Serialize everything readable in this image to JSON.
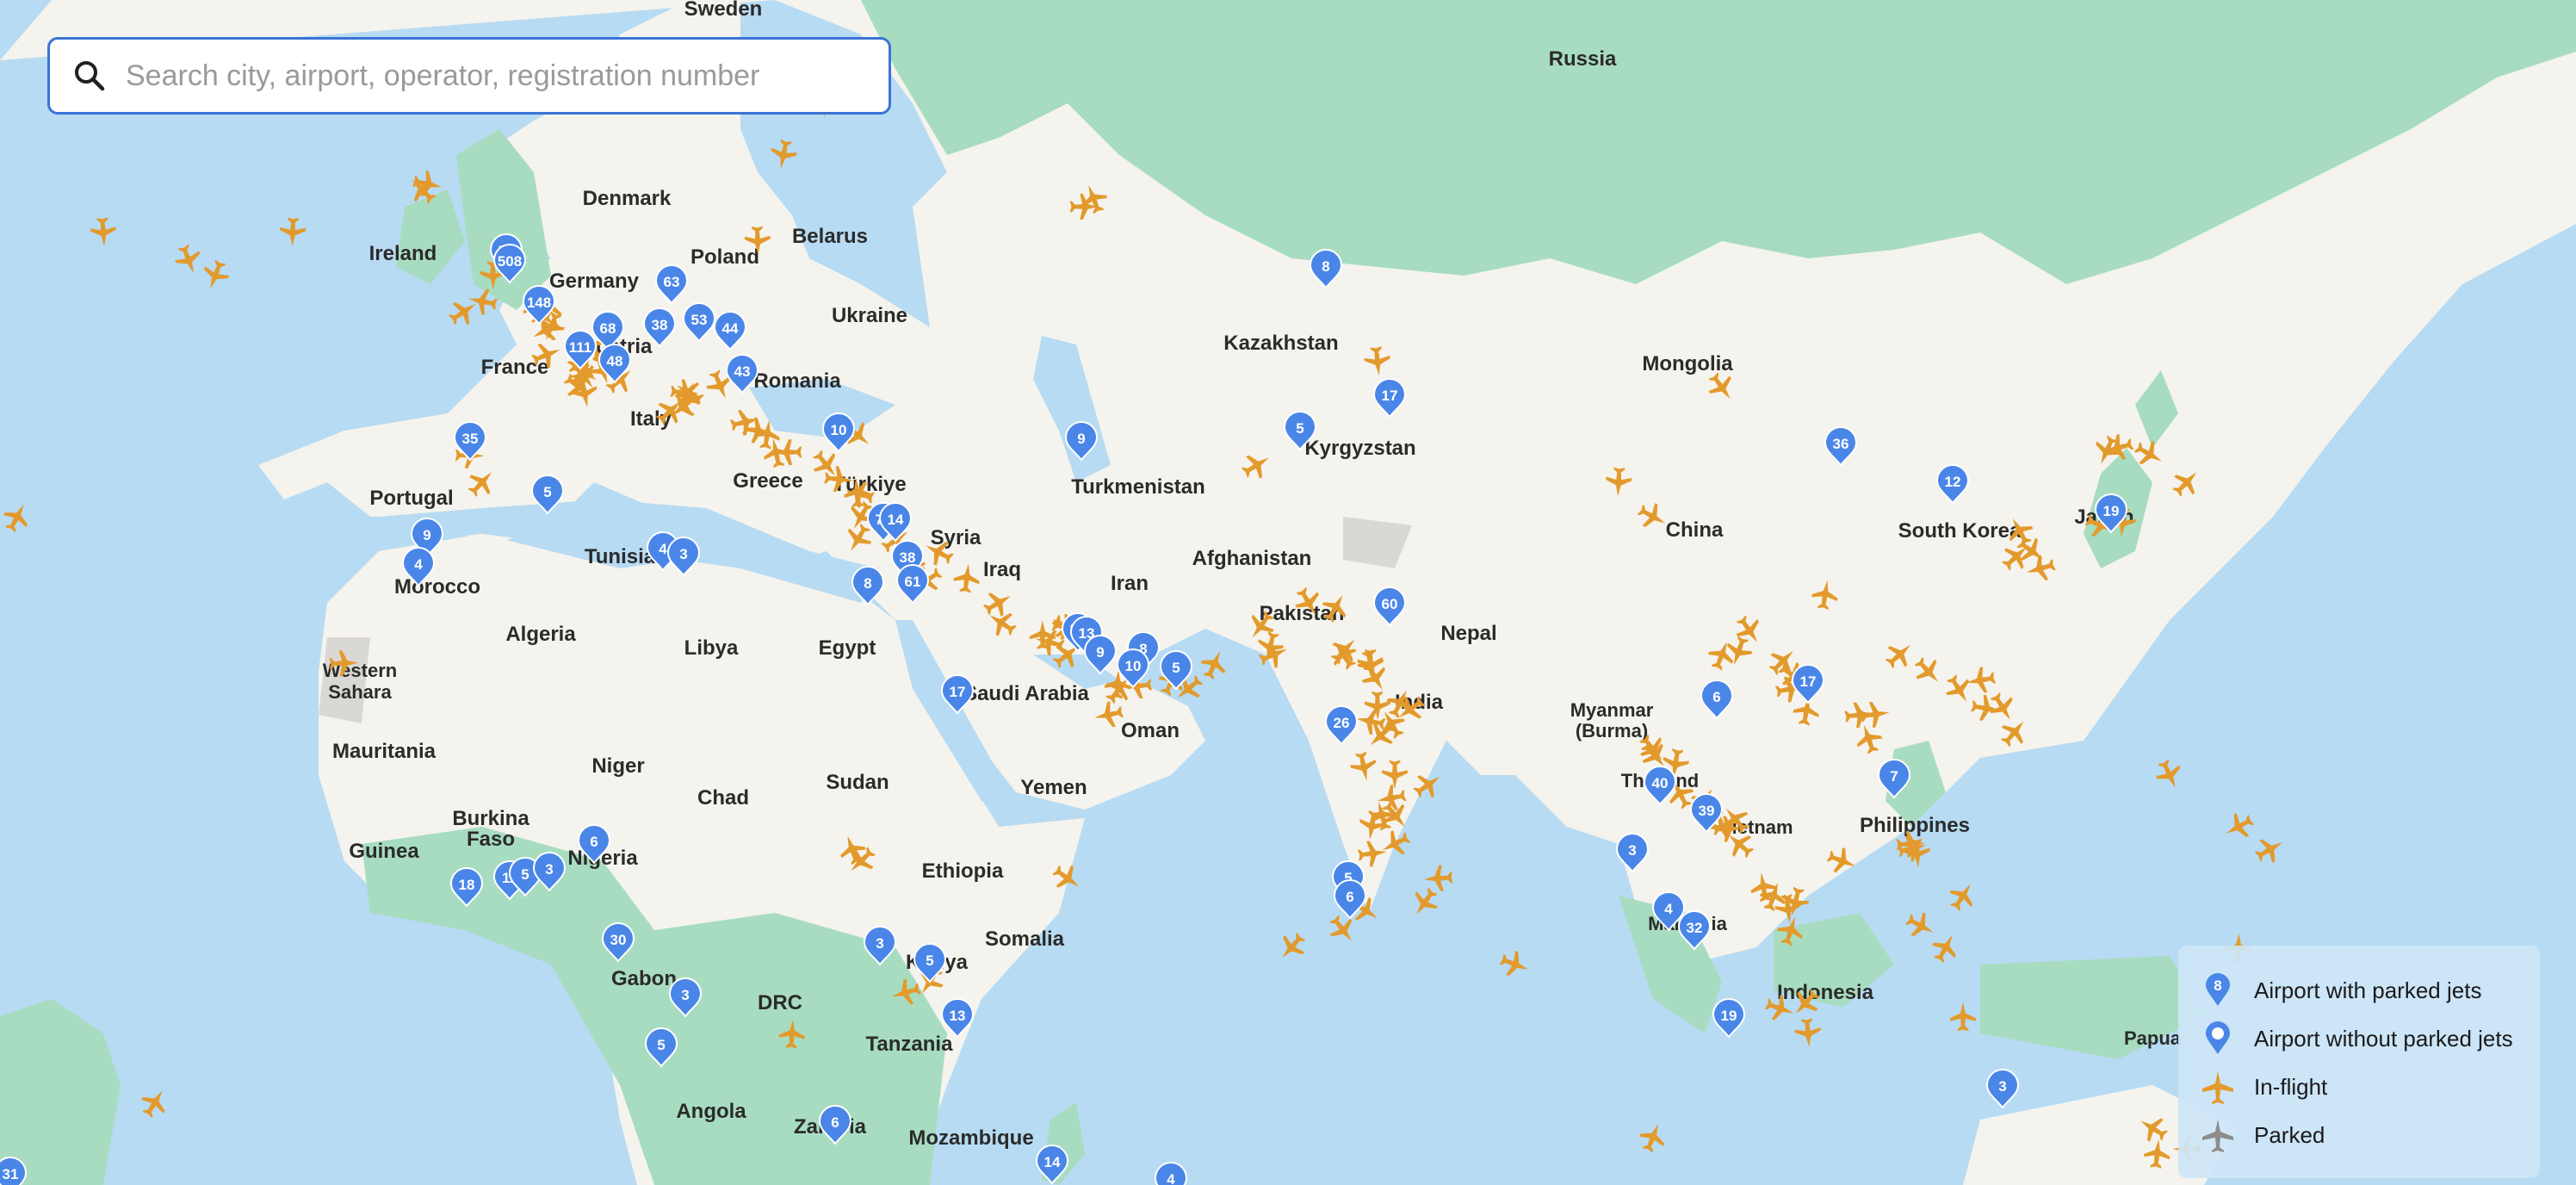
{
  "search": {
    "placeholder": "Search city, airport, operator, registration number"
  },
  "countries": [
    {
      "name": "Sweden"
    },
    {
      "name": "Russia"
    },
    {
      "name": "Denmark"
    },
    {
      "name": "Ireland"
    },
    {
      "name": "Poland"
    },
    {
      "name": "Belarus"
    },
    {
      "name": "Germany"
    },
    {
      "name": "Ukraine"
    },
    {
      "name": "Kazakhstan"
    },
    {
      "name": "Mongolia"
    },
    {
      "name": "Austria"
    },
    {
      "name": "France"
    },
    {
      "name": "Romania"
    },
    {
      "name": "Kyrgyzstan"
    },
    {
      "name": "Italy"
    },
    {
      "name": "Portugal"
    },
    {
      "name": "Greece"
    },
    {
      "name": "Türkiye"
    },
    {
      "name": "Turkmenistan"
    },
    {
      "name": "China"
    },
    {
      "name": "South Korea"
    },
    {
      "name": "Japan"
    },
    {
      "name": "Tunisia"
    },
    {
      "name": "Syria"
    },
    {
      "name": "Morocco"
    },
    {
      "name": "Iraq"
    },
    {
      "name": "Afghanistan"
    },
    {
      "name": "Iran"
    },
    {
      "name": "Algeria"
    },
    {
      "name": "Libya"
    },
    {
      "name": "Egypt"
    },
    {
      "name": "Pakistan"
    },
    {
      "name": "Nepal"
    },
    {
      "name": "Western"
    },
    {
      "name": "Sahara"
    },
    {
      "name": "Saudi Arabia"
    },
    {
      "name": "India"
    },
    {
      "name": "Oman"
    },
    {
      "name": "Myanmar"
    },
    {
      "name": "(Burma)"
    },
    {
      "name": "Mauritania"
    },
    {
      "name": "Niger"
    },
    {
      "name": "Sudan"
    },
    {
      "name": "Chad"
    },
    {
      "name": "Thailand"
    },
    {
      "name": "Yemen"
    },
    {
      "name": "Vietnam"
    },
    {
      "name": "Philippines"
    },
    {
      "name": "Burkina"
    },
    {
      "name": "Faso"
    },
    {
      "name": "Ethiopia"
    },
    {
      "name": "Nigeria"
    },
    {
      "name": "Guinea"
    },
    {
      "name": "Malaysia"
    },
    {
      "name": "Somalia"
    },
    {
      "name": "Gabon"
    },
    {
      "name": "Kenya"
    },
    {
      "name": "DRC"
    },
    {
      "name": "Indonesia"
    },
    {
      "name": "Tanzania"
    },
    {
      "name": "Angola"
    },
    {
      "name": "Zambia"
    },
    {
      "name": "Mozambique"
    },
    {
      "name": "Papua"
    }
  ],
  "airport_counts": [
    "8",
    "52",
    "508",
    "148",
    "63",
    "38",
    "53",
    "68",
    "44",
    "111",
    "48",
    "43",
    "17",
    "5",
    "36",
    "35",
    "9",
    "10",
    "5",
    "71",
    "14",
    "4",
    "3",
    "9",
    "4",
    "8",
    "38",
    "61",
    "60",
    "57",
    "13",
    "8",
    "9",
    "10",
    "5",
    "17",
    "26",
    "6",
    "17",
    "12",
    "19",
    "7",
    "40",
    "39",
    "3",
    "4",
    "32",
    "19",
    "5",
    "6",
    "6",
    "18",
    "11",
    "5",
    "3",
    "30",
    "3",
    "3",
    "5",
    "13",
    "5",
    "6",
    "3",
    "14",
    "4",
    "31"
  ],
  "legend": {
    "parked_count": "8",
    "items": [
      {
        "label": "Airport with parked jets"
      },
      {
        "label": "Airport without parked jets"
      },
      {
        "label": "In-flight"
      },
      {
        "label": "Parked"
      }
    ]
  },
  "colors": {
    "water": "#b7dbf3",
    "land": "#f5f3ed",
    "forest": "#a8dcc0",
    "marker": "#4a86e8",
    "inflight": "#e39a2c",
    "parked": "#8d8d8d"
  }
}
